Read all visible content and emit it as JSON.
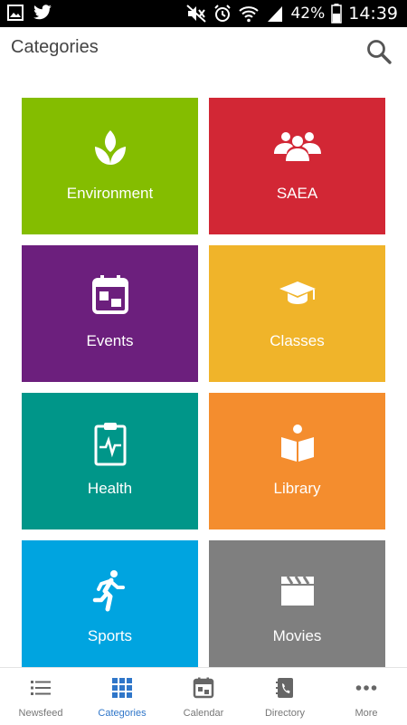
{
  "status_bar": {
    "icons": [
      "gallery-icon",
      "twitter-icon",
      "mute-icon",
      "alarm-icon",
      "wifi-icon",
      "signal-icon",
      "battery-icon"
    ],
    "battery": "42%",
    "time": "14:39"
  },
  "header": {
    "title": "Categories",
    "search_icon": "search-icon"
  },
  "tiles": [
    {
      "label": "Environment",
      "color": "#84bd00",
      "icon": "leaf-icon"
    },
    {
      "label": "SAEA",
      "color": "#d22735",
      "icon": "group-icon"
    },
    {
      "label": "Events",
      "color": "#6c1f7d",
      "icon": "calendar-icon"
    },
    {
      "label": "Classes",
      "color": "#f0b42a",
      "icon": "graduation-cap-icon"
    },
    {
      "label": "Health",
      "color": "#009689",
      "icon": "clipboard-pulse-icon"
    },
    {
      "label": "Library",
      "color": "#f48d2e",
      "icon": "book-reader-icon"
    },
    {
      "label": "Sports",
      "color": "#00a4e0",
      "icon": "runner-icon"
    },
    {
      "label": "Movies",
      "color": "#7f7f7f",
      "icon": "clapperboard-icon"
    }
  ],
  "bottom_nav": {
    "items": [
      {
        "label": "Newsfeed",
        "icon": "list-icon",
        "active": false
      },
      {
        "label": "Categories",
        "icon": "grid-icon",
        "active": true
      },
      {
        "label": "Calendar",
        "icon": "calendar-icon",
        "active": false
      },
      {
        "label": "Directory",
        "icon": "contact-book-icon",
        "active": false
      },
      {
        "label": "More",
        "icon": "more-dots-icon",
        "active": false
      }
    ],
    "active_color": "#2f76c9",
    "inactive_color": "#777777"
  }
}
